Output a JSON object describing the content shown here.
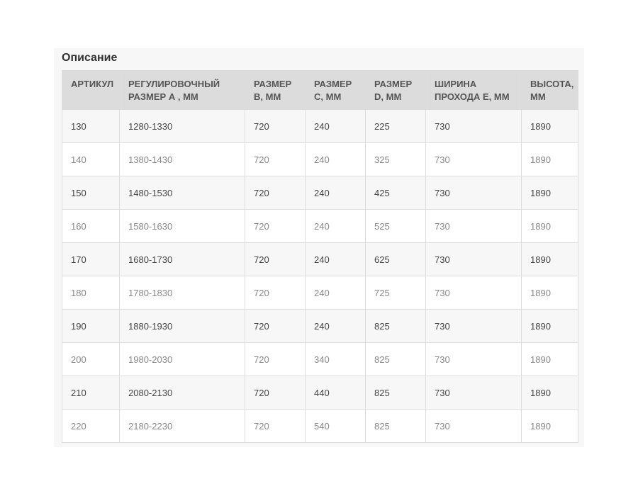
{
  "section": {
    "title": "Описание"
  },
  "table": {
    "headers": [
      {
        "line1": "АРТИКУЛ",
        "line2": ""
      },
      {
        "line1": "РЕГУЛИРОВОЧНЫЙ",
        "line2": "РАЗМЕР А , ММ"
      },
      {
        "line1": "РАЗМЕР",
        "line2": "B, ММ"
      },
      {
        "line1": "РАЗМЕР",
        "line2": "C, ММ"
      },
      {
        "line1": "РАЗМЕР",
        "line2": "D, ММ"
      },
      {
        "line1": "ШИРИНА",
        "line2": "ПРОХОДА E, ММ"
      },
      {
        "line1": "ВЫСОТА,",
        "line2": "ММ"
      }
    ],
    "rows": [
      [
        "130",
        "1280-1330",
        "720",
        "240",
        "225",
        "730",
        "1890"
      ],
      [
        "140",
        "1380-1430",
        "720",
        "240",
        "325",
        "730",
        "1890"
      ],
      [
        "150",
        "1480-1530",
        "720",
        "240",
        "425",
        "730",
        "1890"
      ],
      [
        "160",
        "1580-1630",
        "720",
        "240",
        "525",
        "730",
        "1890"
      ],
      [
        "170",
        "1680-1730",
        "720",
        "240",
        "625",
        "730",
        "1890"
      ],
      [
        "180",
        "1780-1830",
        "720",
        "240",
        "725",
        "730",
        "1890"
      ],
      [
        "190",
        "1880-1930",
        "720",
        "240",
        "825",
        "730",
        "1890"
      ],
      [
        "200",
        "1980-2030",
        "720",
        "340",
        "825",
        "730",
        "1890"
      ],
      [
        "210",
        "2080-2130",
        "720",
        "440",
        "825",
        "730",
        "1890"
      ],
      [
        "220",
        "2180-2230",
        "720",
        "540",
        "825",
        "730",
        "1890"
      ]
    ]
  }
}
